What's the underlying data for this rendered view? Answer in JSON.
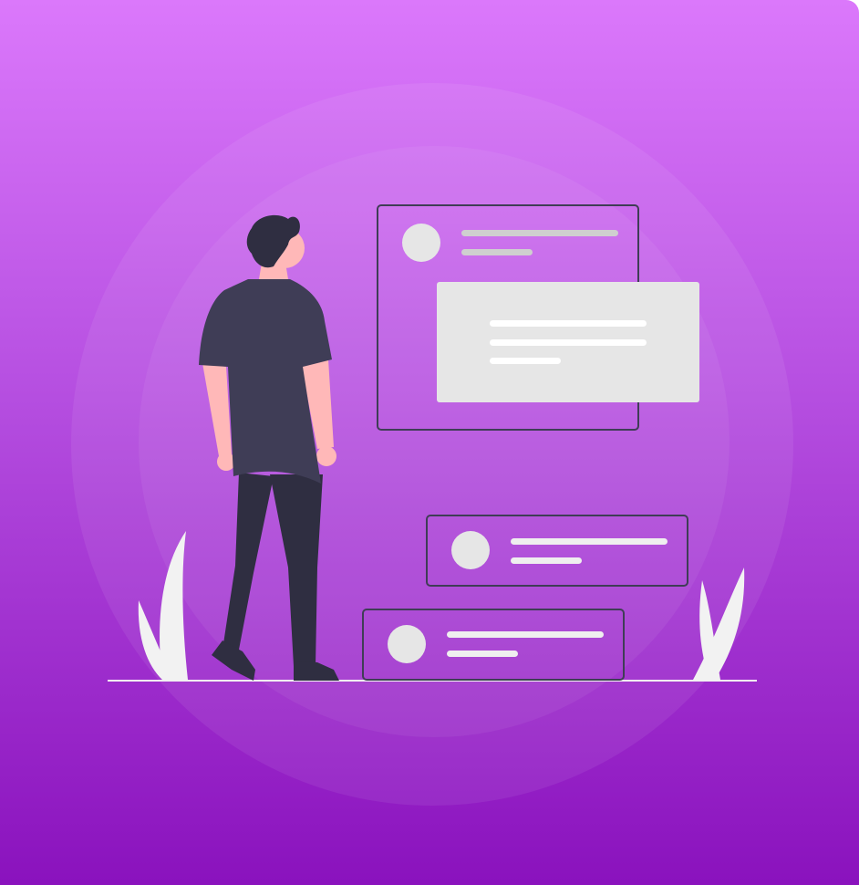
{
  "theme": {
    "background_top": "#db78fb",
    "background_bottom": "#8a12bd",
    "card_outline": "#3f3d56",
    "panel_fill": "#e6e6e6",
    "placeholder_gray": "#cfcfcf",
    "placeholder_light": "#efefef",
    "person_shirt": "#3f3d56",
    "person_pants": "#2f2e41",
    "person_skin": "#ffb8b8",
    "plant_fill": "#f2f2f2"
  },
  "illustration": {
    "subject": "person-viewing-message-cards",
    "message_cards": 3,
    "expanded_panel_text_lines": 3
  }
}
